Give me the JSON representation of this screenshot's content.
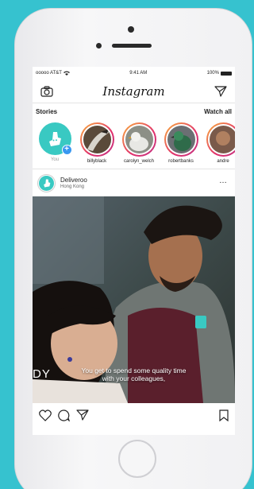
{
  "status_bar": {
    "carrier": "ooooo AT&T",
    "time": "9:41 AM",
    "battery": "100%"
  },
  "header": {
    "logo": "Instagram",
    "left_icon": "camera-icon",
    "right_icon": "direct-send-icon"
  },
  "stories": {
    "title": "Stories",
    "watch_all": "Watch all",
    "items": [
      {
        "label": "You",
        "kind": "own"
      },
      {
        "label": "billyblack",
        "kind": "ring"
      },
      {
        "label": "carolyn_welch",
        "kind": "ring"
      },
      {
        "label": "robertbanks",
        "kind": "ring"
      },
      {
        "label": "andre",
        "kind": "ring"
      }
    ]
  },
  "post": {
    "username": "Deliveroo",
    "location": "Hong Kong",
    "more": "…",
    "caption_line1": "You get to spend some quality time",
    "caption_line2": "with your colleagues,",
    "caption_partial": "DY"
  },
  "colors": {
    "background": "#36c2cf",
    "brand_teal": "#39c9c2",
    "story_ring": "#e1306c"
  }
}
